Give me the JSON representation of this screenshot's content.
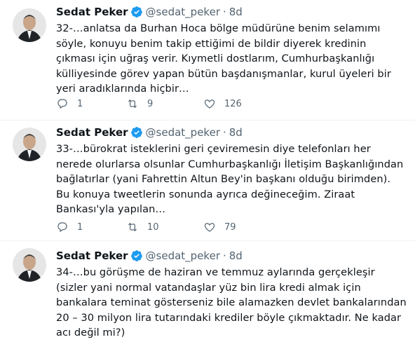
{
  "tweets": [
    {
      "name": "Sedat Peker",
      "handle": "@sedat_peker",
      "separator": "·",
      "time": "8d",
      "text": "32-…anlatsa da Burhan Hoca bölge müdürüne benim selamımı\nsöyle, konuyu benim takip ettiğimi de bildir diyerek kredinin\nçıkması için uğraş verir. Kıymetli dostlarım, Cumhurbaşkanlığı\nkülliyesinde görev yapan bütün başdanışmanlar, kurul üyeleri bir\nyeri aradıklarında hiçbir…",
      "replies": "1",
      "retweets": "9",
      "likes": "126"
    },
    {
      "name": "Sedat Peker",
      "handle": "@sedat_peker",
      "separator": "·",
      "time": "8d",
      "text": "33-…bürokrat isteklerini geri çeviremesin diye telefonları her\nnerede olurlarsa olsunlar Cumhurbaşkanlığı İletişim Başkanlığından\nbağlatırlar (yani Fahrettin Altun Bey'in başkanı olduğu birimden).\nBu konuya tweetlerin sonunda ayrıca değineceğim. Ziraat\nBankası'yla yapılan…",
      "replies": "1",
      "retweets": "10",
      "likes": "79"
    },
    {
      "name": "Sedat Peker",
      "handle": "@sedat_peker",
      "separator": "·",
      "time": "8d",
      "text": "34-…bu görüşme de haziran ve temmuz aylarında gerçekleşir\n(sizler yani normal vatandaşlar yüz bin lira kredi almak için\nbankalara teminat gösterseniz bile alamazken devlet bankalarından\n20 – 30 milyon lira tutarındaki krediler böyle çıkmaktadır. Ne kadar\nacı değil mi?)"
    }
  ],
  "icons": {
    "verified": "verified-badge-icon",
    "reply": "reply-icon",
    "retweet": "retweet-icon",
    "like": "like-icon"
  },
  "colors": {
    "text": "#0f1419",
    "secondary": "#536471",
    "verified": "#1d9bf0",
    "divider": "#eff3f4"
  }
}
